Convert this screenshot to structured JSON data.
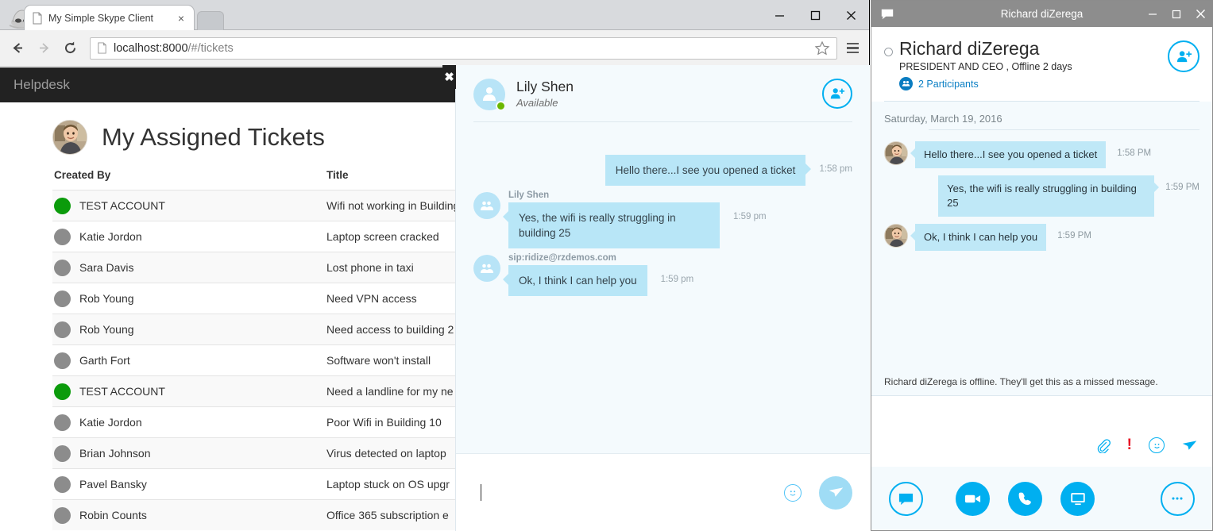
{
  "browser": {
    "incognito_icon": "incognito-spy-icon",
    "tab": {
      "title": "My Simple Skype Client",
      "close_label": "×",
      "favicon": "page-icon"
    },
    "window_controls": {
      "minimize": "minimize-icon",
      "maximize": "maximize-icon",
      "close": "close-icon"
    },
    "toolbar": {
      "back": "back-arrow-icon",
      "forward": "forward-arrow-icon",
      "reload": "reload-icon",
      "url_host": "localhost:8000",
      "url_path": "/#/tickets",
      "star": "bookmark-star-icon",
      "menu": "hamburger-menu-icon"
    }
  },
  "helpdesk": {
    "brand": "Helpdesk",
    "page_title": "My Assigned Tickets",
    "avatar": "user-photo-avatar",
    "columns": {
      "created_by": "Created By",
      "title": "Title"
    },
    "tickets": [
      {
        "created_by": "TEST ACCOUNT",
        "title": "Wifi not working in Building",
        "presence": "online"
      },
      {
        "created_by": "Katie Jordon",
        "title": "Laptop screen cracked",
        "presence": "offline"
      },
      {
        "created_by": "Sara Davis",
        "title": "Lost phone in taxi",
        "presence": "offline"
      },
      {
        "created_by": "Rob Young",
        "title": "Need VPN access",
        "presence": "offline"
      },
      {
        "created_by": "Rob Young",
        "title": "Need access to building 2",
        "presence": "offline"
      },
      {
        "created_by": "Garth Fort",
        "title": "Software won't install",
        "presence": "offline"
      },
      {
        "created_by": "TEST ACCOUNT",
        "title": "Need a landline for my ne",
        "presence": "online"
      },
      {
        "created_by": "Katie Jordon",
        "title": "Poor Wifi in Building 10",
        "presence": "offline"
      },
      {
        "created_by": "Brian Johnson",
        "title": "Virus detected on laptop",
        "presence": "offline"
      },
      {
        "created_by": "Pavel Bansky",
        "title": "Laptop stuck on OS upgr",
        "presence": "offline"
      },
      {
        "created_by": "Robin Counts",
        "title": "Office 365 subscription e",
        "presence": "offline"
      }
    ]
  },
  "web_chat": {
    "close_label": "✖",
    "contact_name": "Lily Shen",
    "contact_status": "Available",
    "add_participant_icon": "add-person-icon",
    "messages": [
      {
        "sender": "",
        "text": "Hello there...I see you opened a ticket",
        "time": "1:58 pm",
        "direction": "out"
      },
      {
        "sender": "Lily Shen",
        "text": "Yes, the wifi is really struggling in building 25",
        "time": "1:59 pm",
        "direction": "in"
      },
      {
        "sender": "sip:ridize@rzdemos.com",
        "text": "Ok, I think I can help you",
        "time": "1:59 pm",
        "direction": "in"
      }
    ],
    "input_value": "",
    "input_placeholder": "",
    "emoji_icon": "emoji-smiley-icon",
    "send_icon": "send-paper-plane-icon"
  },
  "skype": {
    "titlebar": {
      "icon": "skype-chat-bubble-icon",
      "title": "Richard diZerega",
      "minimize": "minimize-icon",
      "maximize": "maximize-icon",
      "close": "close-icon"
    },
    "contact_name": "Richard diZerega",
    "contact_subtitle": "PRESIDENT AND CEO ,  Offline 2 days",
    "participants_label": "2 Participants",
    "participants_icon": "people-group-icon",
    "add_participant_icon": "add-person-icon",
    "date_divider": "Saturday, March 19, 2016",
    "messages": [
      {
        "text": "Hello there...I see you opened a ticket",
        "time": "1:58 PM",
        "direction": "in"
      },
      {
        "text": "Yes, the wifi is really struggling in building 25",
        "time": "1:59 PM",
        "direction": "out"
      },
      {
        "text": "Ok, I think I can help you",
        "time": "1:59 PM",
        "direction": "in"
      }
    ],
    "offline_note": "Richard diZerega is offline. They'll get this as a missed message.",
    "compose_icons": {
      "attach": "paperclip-icon",
      "importance": "exclamation-important-icon",
      "emoji": "emoji-smiley-icon",
      "send": "send-paper-plane-icon"
    },
    "action_icons": {
      "chat": "chat-bubble-icon",
      "video": "video-camera-icon",
      "call": "phone-handset-icon",
      "screen_share": "monitor-screenshare-icon",
      "more": "more-ellipsis-icon"
    }
  },
  "colors": {
    "skype_blue": "#00aff0",
    "bubble_blue": "#bfe8f7",
    "online_green": "#0b9b0b",
    "navbar_dark": "#222222",
    "alert_red": "#e81123"
  }
}
